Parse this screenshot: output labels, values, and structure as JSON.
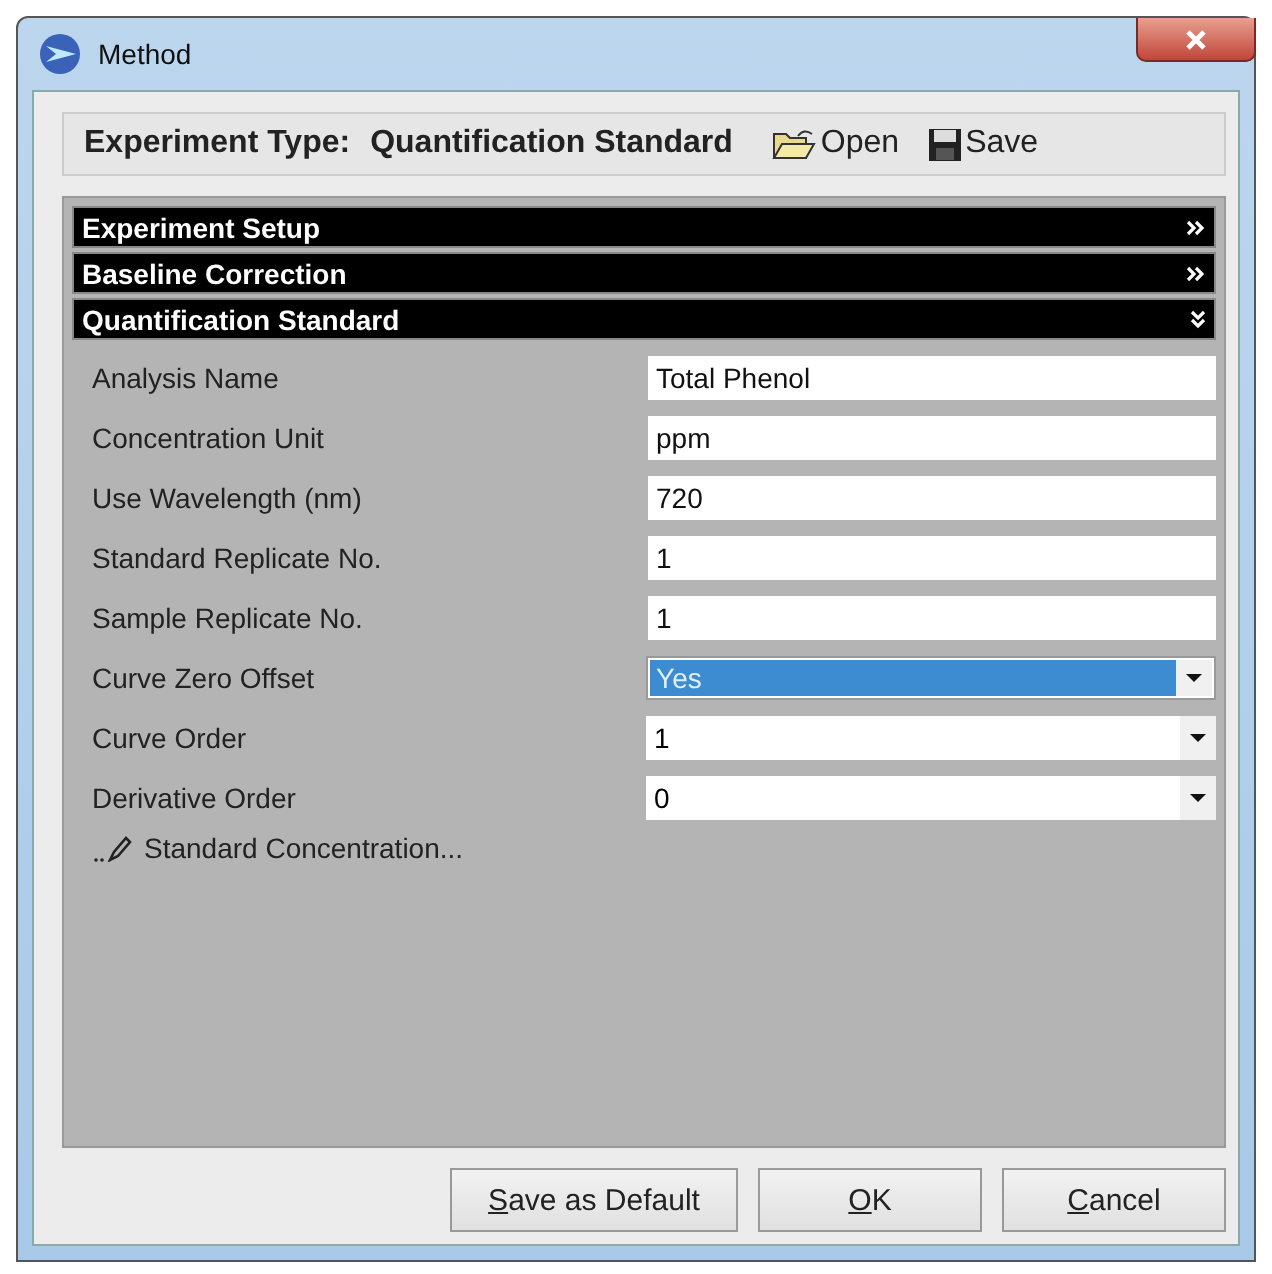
{
  "window": {
    "title": "Method"
  },
  "header": {
    "label": "Experiment Type:",
    "value": "Quantification Standard",
    "actions": [
      {
        "kind": "open",
        "label": "Open"
      },
      {
        "kind": "save",
        "label": "Save"
      }
    ]
  },
  "sections": [
    {
      "title": "Experiment Setup",
      "expanded": false
    },
    {
      "title": "Baseline Correction",
      "expanded": false
    },
    {
      "title": "Quantification Standard",
      "expanded": true
    }
  ],
  "fields": [
    {
      "kind": "text",
      "label": "Analysis Name",
      "value": "Total Phenol"
    },
    {
      "kind": "text",
      "label": "Concentration Unit",
      "value": "ppm"
    },
    {
      "kind": "text",
      "label": "Use Wavelength (nm)",
      "value": "720"
    },
    {
      "kind": "text",
      "label": "Standard Replicate No.",
      "value": "1"
    },
    {
      "kind": "text",
      "label": "Sample Replicate No.",
      "value": "1"
    },
    {
      "kind": "dropdown",
      "label": "Curve Zero Offset",
      "value": "Yes",
      "selected": true
    },
    {
      "kind": "dropdown",
      "label": "Curve Order",
      "value": "1",
      "selected": false
    },
    {
      "kind": "dropdown",
      "label": "Derivative Order",
      "value": "0",
      "selected": false
    }
  ],
  "link": {
    "label": "Standard Concentration..."
  },
  "buttons": [
    {
      "access_key": "S",
      "rest": "ave as Default"
    },
    {
      "access_key": "O",
      "rest": "K"
    },
    {
      "access_key": "C",
      "rest": "ancel"
    }
  ]
}
